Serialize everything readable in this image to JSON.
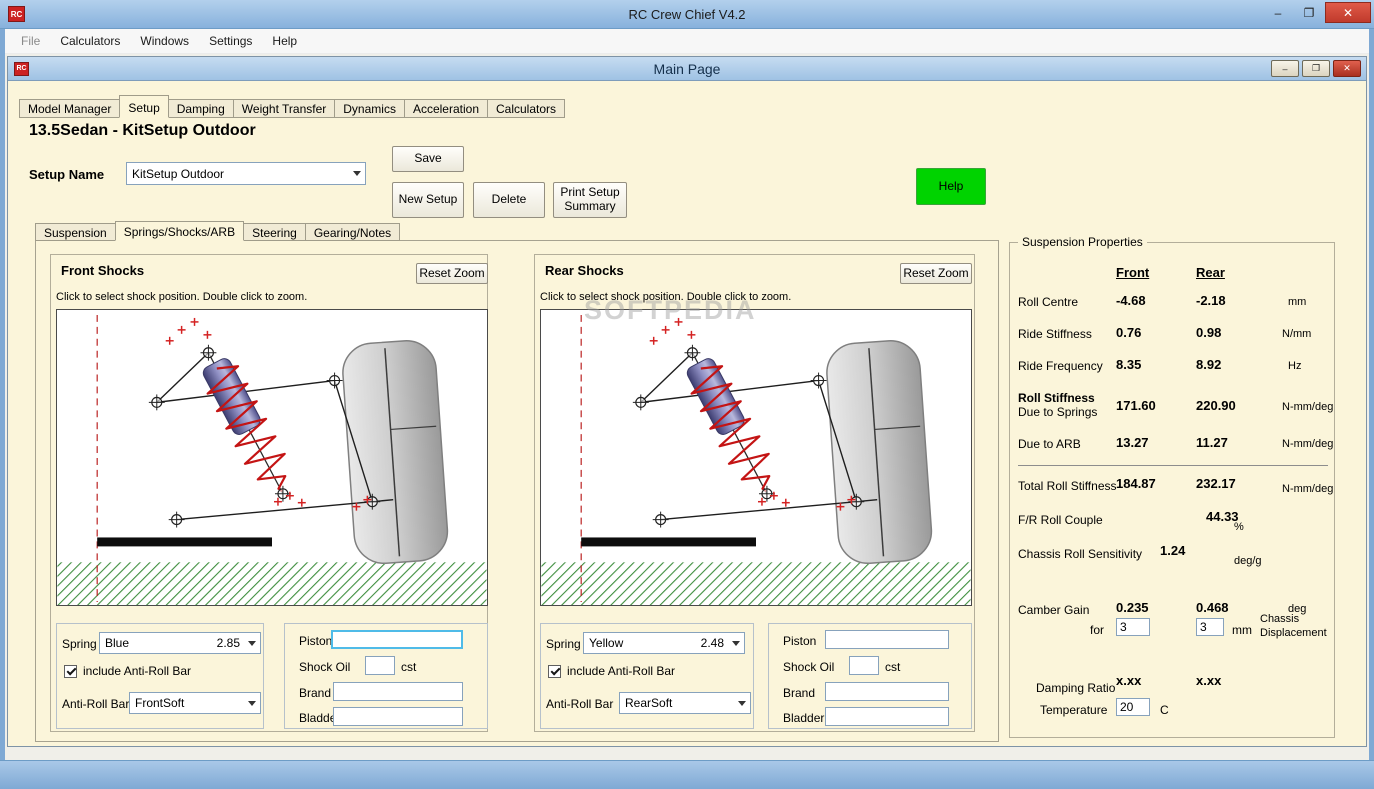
{
  "window": {
    "title": "RC Crew Chief V4.2",
    "app_icon": "RC",
    "minimize_icon": "–",
    "maximize_icon": "❐",
    "close_icon": "✕"
  },
  "menu": {
    "items": [
      "File",
      "Calculators",
      "Windows",
      "Settings",
      "Help"
    ]
  },
  "mdi": {
    "title": "Main Page",
    "minimize_icon": "–",
    "maximize_icon": "❐",
    "close_icon": "✕"
  },
  "main_tabs": [
    "Model Manager",
    "Setup",
    "Damping",
    "Weight Transfer",
    "Dynamics",
    "Acceleration",
    "Calculators"
  ],
  "page": {
    "heading": "13.5Sedan - KitSetup Outdoor",
    "setup_name_label": "Setup Name",
    "setup_name_value": "KitSetup Outdoor",
    "save_button": "Save",
    "new_setup_button": "New Setup",
    "delete_button": "Delete",
    "print_button": "Print Setup Summary",
    "help_button": "Help"
  },
  "sub_tabs": [
    "Suspension",
    "Springs/Shocks/ARB",
    "Steering",
    "Gearing/Notes"
  ],
  "front_shocks": {
    "title": "Front Shocks",
    "reset_zoom_button": "Reset Zoom",
    "hint": "Click to select shock position. Double click to zoom.",
    "spring_label": "Spring",
    "spring_name": "Blue",
    "spring_rate": "2.85",
    "include_arb_label": "include Anti-Roll Bar",
    "include_arb_checked": true,
    "arb_label": "Anti-Roll Bar",
    "arb_value": "FrontSoft",
    "piston_label": "Piston",
    "piston_value": "",
    "shock_oil_label": "Shock Oil",
    "shock_oil_value": "",
    "shock_oil_unit": "cst",
    "brand_label": "Brand",
    "brand_value": "",
    "bladder_label": "Bladder",
    "bladder_value": ""
  },
  "rear_shocks": {
    "title": "Rear Shocks",
    "reset_zoom_button": "Reset Zoom",
    "hint": "Click to select shock position. Double click to zoom.",
    "spring_label": "Spring",
    "spring_name": "Yellow",
    "spring_rate": "2.48",
    "include_arb_label": "include Anti-Roll Bar",
    "include_arb_checked": true,
    "arb_label": "Anti-Roll Bar",
    "arb_value": "RearSoft",
    "piston_label": "Piston",
    "piston_value": "",
    "shock_oil_label": "Shock Oil",
    "shock_oil_value": "",
    "shock_oil_unit": "cst",
    "brand_label": "Brand",
    "brand_value": "",
    "bladder_label": "Bladder",
    "bladder_value": ""
  },
  "properties": {
    "title": "Suspension Properties",
    "front_header": "Front",
    "rear_header": "Rear",
    "roll_centre": {
      "label": "Roll Centre",
      "front": "-4.68",
      "rear": "-2.18",
      "unit": "mm"
    },
    "ride_stiffness": {
      "label": "Ride Stiffness",
      "front": "0.76",
      "rear": "0.98",
      "unit": "N/mm"
    },
    "ride_frequency": {
      "label": "Ride Frequency",
      "front": "8.35",
      "rear": "8.92",
      "unit": "Hz"
    },
    "roll_stiffness_header": "Roll Stiffness",
    "due_to_springs": {
      "label": "Due to Springs",
      "front": "171.60",
      "rear": "220.90",
      "unit": "N-mm/deg"
    },
    "due_to_arb": {
      "label": "Due to ARB",
      "front": "13.27",
      "rear": "11.27",
      "unit": "N-mm/deg"
    },
    "total_roll_stiffness": {
      "label": "Total Roll Stiffness",
      "front": "184.87",
      "rear": "232.17",
      "unit": "N-mm/deg"
    },
    "fr_roll_couple": {
      "label": "F/R Roll Couple",
      "value": "44.33",
      "unit": "%"
    },
    "chassis_roll_sensitivity": {
      "label": "Chassis Roll Sensitivity",
      "value": "1.24",
      "unit": "deg/g"
    },
    "camber_gain": {
      "label": "Camber Gain",
      "front": "0.235",
      "rear": "0.468",
      "unit": "deg"
    },
    "displacement": {
      "label": "for",
      "front": "3",
      "rear": "3",
      "unit": "mm",
      "note": "Chassis Displacement"
    },
    "damping_ratio": {
      "label": "Damping Ratio",
      "front": "x.xx",
      "rear": "x.xx"
    },
    "temperature": {
      "label": "Temperature",
      "value": "20",
      "unit": "C"
    }
  },
  "watermark": "SOFTPEDIA"
}
